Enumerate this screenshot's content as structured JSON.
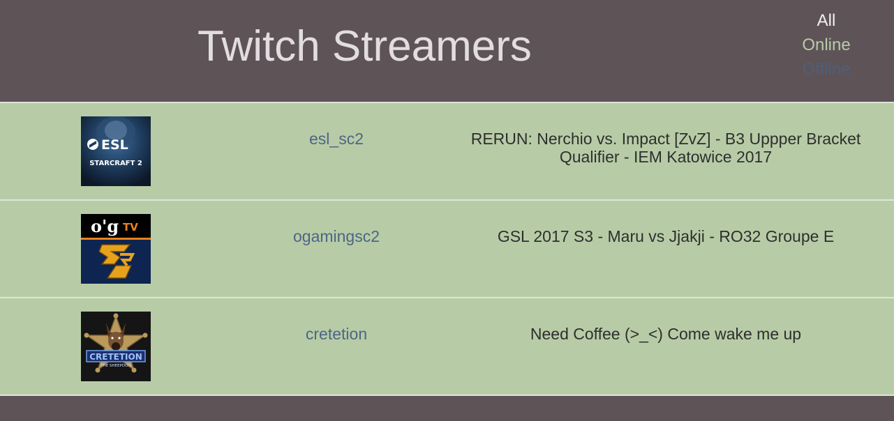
{
  "header": {
    "title": "Twitch Streamers",
    "filters": {
      "all": "All",
      "online": "Online",
      "offline": "Offline"
    }
  },
  "colors": {
    "header_bg": "#5e5458",
    "row_bg": "#b7cca6",
    "link": "#4d6586",
    "online": "#b6cca6",
    "offline": "#4d5f7a"
  },
  "streamers": [
    {
      "name": "esl_sc2",
      "status": "RERUN: Nerchio vs. Impact [ZvZ] - B3 Uppper Bracket Qualifier - IEM Katowice 2017",
      "logo": {
        "icon": "esl-starcraft2-logo",
        "text_top": "ESL",
        "text_bottom": "STARCRAFT 2"
      }
    },
    {
      "name": "ogamingsc2",
      "status": "GSL 2017 S3 - Maru vs Jjakji - RO32 Groupe E",
      "logo": {
        "icon": "ogtv-sc-logo",
        "text_top": "o'g",
        "text_tv": "TV",
        "text_mark": "SC"
      }
    },
    {
      "name": "cretetion",
      "status": "Need Coffee (>_<) Come wake me up",
      "logo": {
        "icon": "cretetion-dog-badge-logo",
        "text_top": "CRETETION",
        "text_bottom": "THE SHEEPDOG"
      }
    }
  ]
}
